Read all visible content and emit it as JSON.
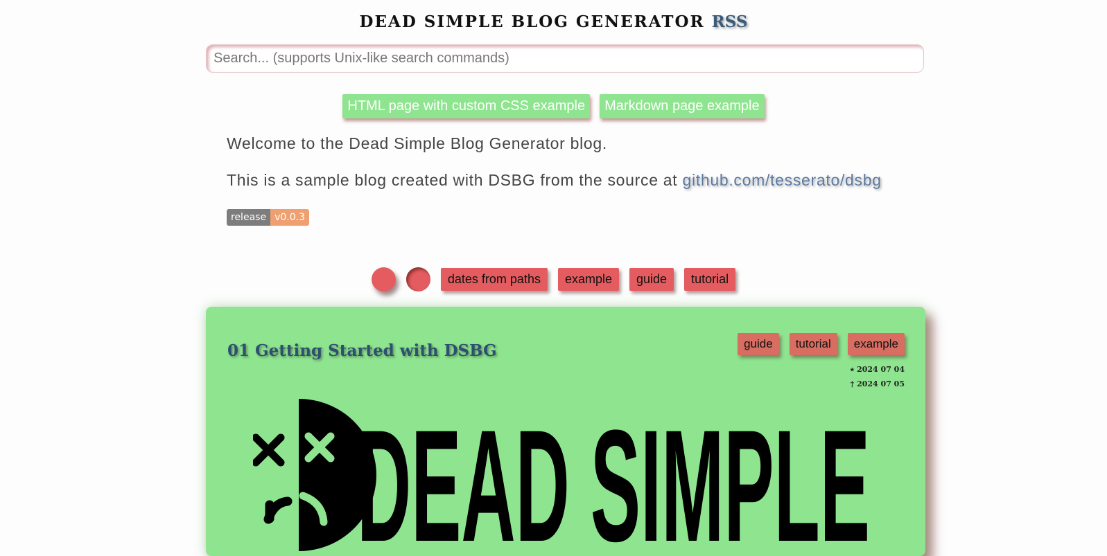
{
  "header": {
    "title": "DEAD SIMPLE BLOG GENERATOR",
    "rss_label": "RSS"
  },
  "search": {
    "placeholder": "Search... (supports Unix-like search commands)"
  },
  "top_links": [
    {
      "label": "HTML page with custom CSS example"
    },
    {
      "label": "Markdown page example"
    }
  ],
  "intro": {
    "welcome": "Welcome to the Dead Simple Blog Generator blog.",
    "source_text": "This is a sample blog created with DSBG from the source at ",
    "source_link": "github.com/tesserato/dsbg"
  },
  "badge": {
    "label": "release",
    "version": "v0.0.3"
  },
  "tag_bar": {
    "tags": [
      "dates from paths",
      "example",
      "guide",
      "tutorial"
    ]
  },
  "post": {
    "title": "01 Getting Started with DSBG",
    "tags": [
      "guide",
      "tutorial",
      "example"
    ],
    "created": "⭑ 2024 07 04",
    "updated": "† 2024 07 05",
    "logo_text": "DEAD SIMPLE"
  },
  "colors": {
    "accent_green": "#8ee48f",
    "tag_red": "#e45c5f",
    "post_tag": "#d86e62",
    "link_blue": "#5b7aa0"
  }
}
